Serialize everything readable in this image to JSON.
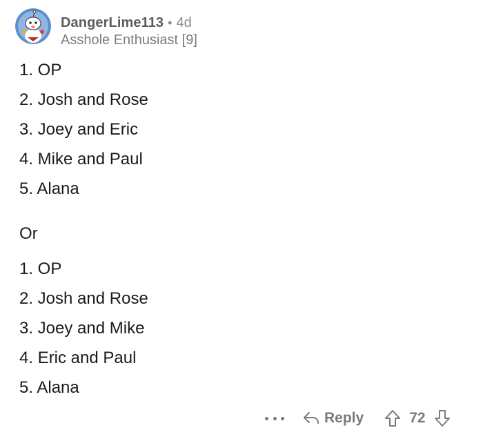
{
  "comment": {
    "author": "DangerLime113",
    "separator": "•",
    "age": "4d",
    "flair": "Asshole Enthusiast [9]",
    "lines_a": [
      "1. OP",
      "2. Josh and Rose",
      "3. Joey and Eric",
      "4. Mike and Paul",
      "5. Alana"
    ],
    "or_label": "Or",
    "lines_b": [
      "1. OP",
      "2. Josh and Rose",
      "3. Joey and Mike",
      "4. Eric and Paul",
      "5. Alana"
    ]
  },
  "actions": {
    "more_icon": "ellipsis-icon",
    "reply_icon": "reply-arrow-icon",
    "reply_label": "Reply",
    "upvote_icon": "upvote-arrow-icon",
    "score": "72",
    "downvote_icon": "downvote-arrow-icon"
  },
  "colors": {
    "text": "#1a1a1a",
    "meta": "#7c7c7c",
    "avatar_bg": "#5b8fc9"
  }
}
